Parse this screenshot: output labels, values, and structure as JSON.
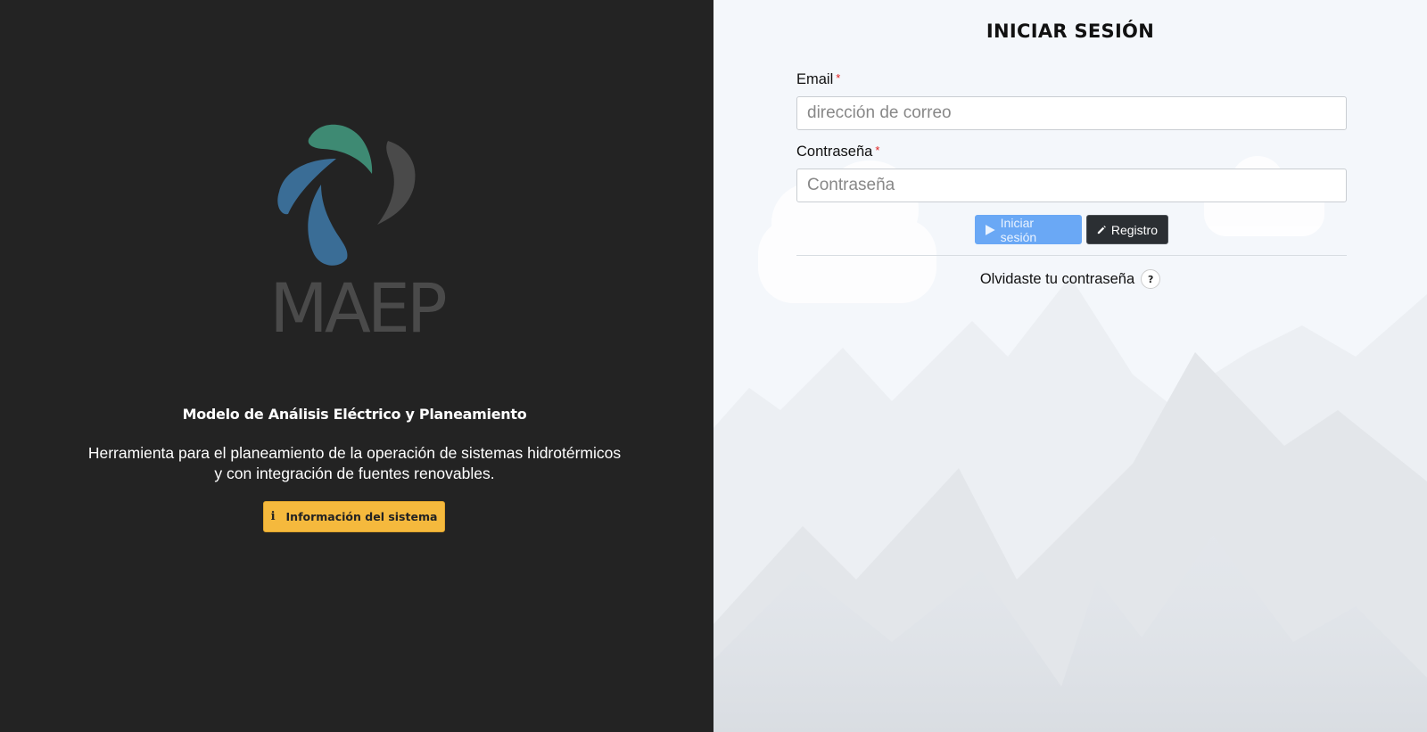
{
  "brand": {
    "logo_text": "MAEP",
    "colors": {
      "leaf_green": "#3e8a73",
      "leaf_blue": "#3a6d96",
      "leaf_gray": "#4a4a4a"
    }
  },
  "left": {
    "title": "Modelo de Análisis Eléctrico y Planeamiento",
    "description": "Herramienta para el planeamiento de la operación de sistemas hidrotérmicos y con integración de fuentes renovables.",
    "info_button": {
      "icon": "info-icon",
      "label": "Información del sistema"
    }
  },
  "login": {
    "title": "INICIAR SESIÓN",
    "email": {
      "label": "Email",
      "required_mark": "*",
      "placeholder": "dirección de correo",
      "value": ""
    },
    "password": {
      "label": "Contraseña",
      "required_mark": "*",
      "placeholder": "Contraseña",
      "value": ""
    },
    "submit": {
      "icon": "play-icon",
      "label": "Iniciar sesión"
    },
    "register": {
      "icon": "pencil-icon",
      "label": "Registro"
    },
    "forgot": {
      "label": "Olvidaste tu contraseña",
      "help_icon": "?"
    }
  }
}
